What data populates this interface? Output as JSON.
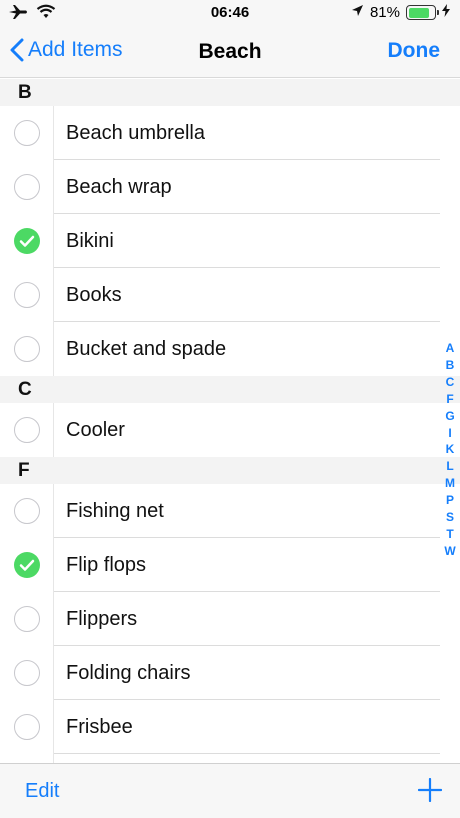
{
  "status_bar": {
    "time": "06:46",
    "battery_percent": "81%",
    "battery_level": 0.81
  },
  "nav": {
    "back_label": "Add Items",
    "title": "Beach",
    "done_label": "Done"
  },
  "sections": [
    {
      "letter": "B",
      "items": [
        {
          "label": "Beach umbrella",
          "checked": false
        },
        {
          "label": "Beach wrap",
          "checked": false
        },
        {
          "label": "Bikini",
          "checked": true
        },
        {
          "label": "Books",
          "checked": false
        },
        {
          "label": "Bucket and spade",
          "checked": false
        }
      ]
    },
    {
      "letter": "C",
      "items": [
        {
          "label": "Cooler",
          "checked": false
        }
      ]
    },
    {
      "letter": "F",
      "items": [
        {
          "label": "Fishing net",
          "checked": false
        },
        {
          "label": "Flip flops",
          "checked": true
        },
        {
          "label": "Flippers",
          "checked": false
        },
        {
          "label": "Folding chairs",
          "checked": false
        },
        {
          "label": "Frisbee",
          "checked": false
        }
      ]
    }
  ],
  "index_letters": [
    "A",
    "B",
    "C",
    "F",
    "G",
    "I",
    "K",
    "L",
    "M",
    "P",
    "S",
    "T",
    "W"
  ],
  "toolbar": {
    "edit_label": "Edit",
    "add_icon": "plus-icon"
  },
  "colors": {
    "accent": "#157efb",
    "check": "#4cd964"
  }
}
